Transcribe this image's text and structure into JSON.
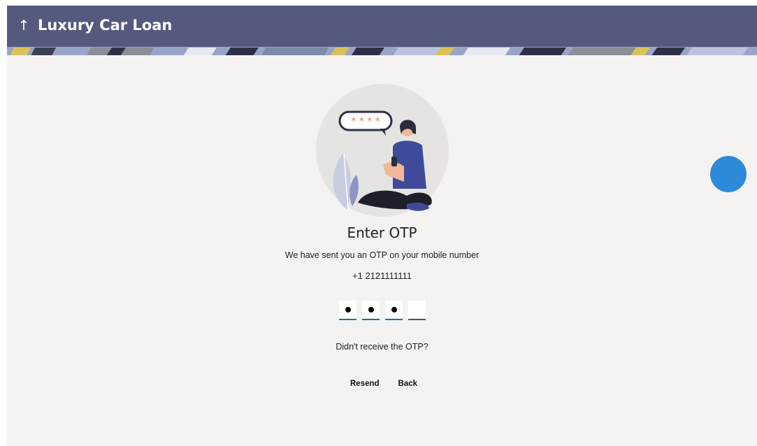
{
  "header": {
    "back_icon": "↑",
    "title": "Luxury Car Loan"
  },
  "otp": {
    "title": "Enter OTP",
    "subtitle": "We have sent you an OTP on your mobile number",
    "phone": "+1 2121111111",
    "digits_filled": 3,
    "digits_total": 4,
    "resend_question": "Didn't receive the OTP?",
    "resend_label": "Resend",
    "back_label": "Back",
    "bubble_text": "* * * *"
  },
  "colors": {
    "header_bg": "#535a7e",
    "page_bg": "#f4f3f1",
    "underline_active": "#1f6f9f",
    "fab": "#2c8ad8"
  }
}
